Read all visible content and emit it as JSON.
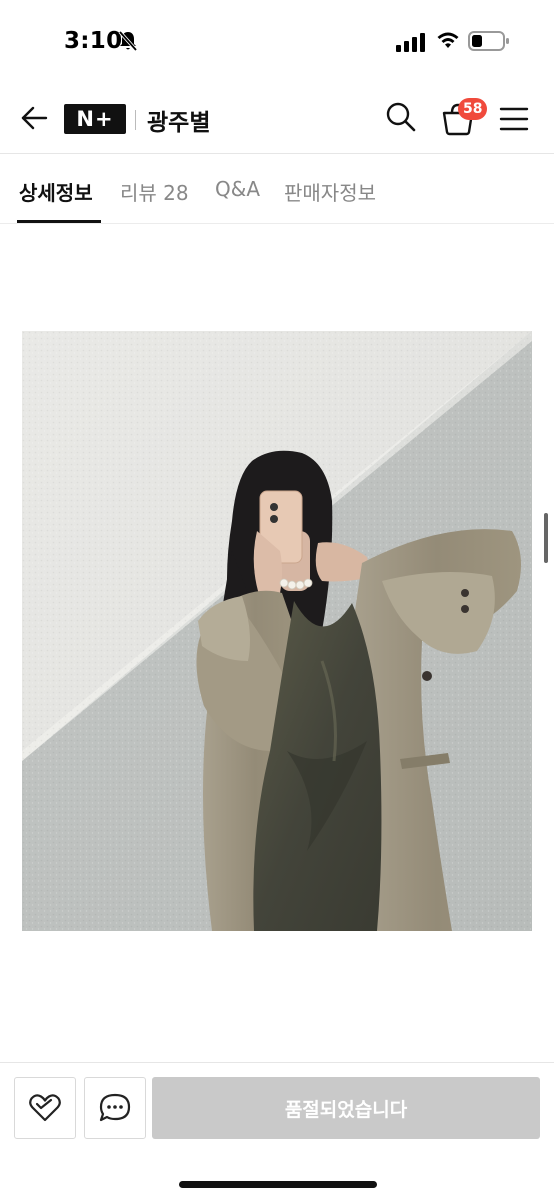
{
  "status_bar": {
    "time": "3:10",
    "icons": [
      "bell-slash-icon",
      "signal-icon",
      "wifi-icon",
      "battery-icon"
    ]
  },
  "header": {
    "brand_logo_text": "N+",
    "store_name": "광주별",
    "cart_count": "58",
    "icons": [
      "back-arrow-icon",
      "search-icon",
      "cart-icon",
      "menu-icon"
    ]
  },
  "tabs": [
    {
      "label": "상세정보",
      "active": true
    },
    {
      "label": "리뷰 28",
      "active": false
    },
    {
      "label": "Q&A",
      "active": false
    },
    {
      "label": "판매자정보",
      "active": false
    }
  ],
  "bottom_bar": {
    "soldout_label": "품절되었습니다",
    "icons": [
      "heart-icon",
      "chat-icon"
    ]
  },
  "colors": {
    "accent_badge": "#f04a3c",
    "disabled_button": "#c9c9c9",
    "text_primary": "#111111",
    "text_muted": "#888888"
  }
}
